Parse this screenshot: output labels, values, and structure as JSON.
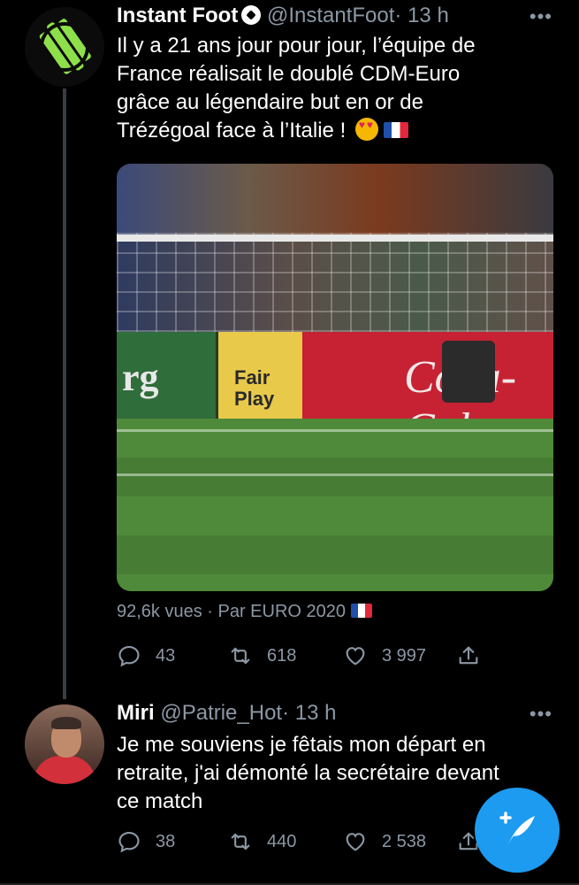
{
  "tweets": [
    {
      "name": "Instant Foot",
      "handle": "@InstantFoot",
      "time": "· 13 h",
      "more": "•••",
      "text_line1": "Il y a 21 ans jour pour jour, l’équipe de",
      "text_line2": "France réalisait le doublé CDM-Euro",
      "text_line3": "grâce au légendaire but en or de",
      "text_line4": "Trézégoal face à l’Italie !",
      "media_boards": [
        "rg",
        "Fair\nPlay",
        "Coca-Cola"
      ],
      "views": "92,6k vues · Par EURO 2020",
      "replies": "43",
      "retweets": "618",
      "likes": "3 997"
    },
    {
      "name": "Miri",
      "handle": "@Patrie_Hot",
      "time": "· 13 h",
      "more": "•••",
      "text_line1": "Je me souviens je fêtais mon départ en",
      "text_line2": "retraite, j'ai démonté la secrétaire devant",
      "text_line3": "ce match",
      "replies": "38",
      "retweets": "440",
      "likes": "2 538"
    }
  ],
  "icons": {
    "reply": "reply-icon",
    "retweet": "retweet-icon",
    "like": "heart-icon",
    "share": "share-icon",
    "compose": "compose-tweet-icon"
  },
  "colors": {
    "accent": "#1d9bf0",
    "muted": "#8b98a5",
    "logo": "#8ee04a"
  }
}
